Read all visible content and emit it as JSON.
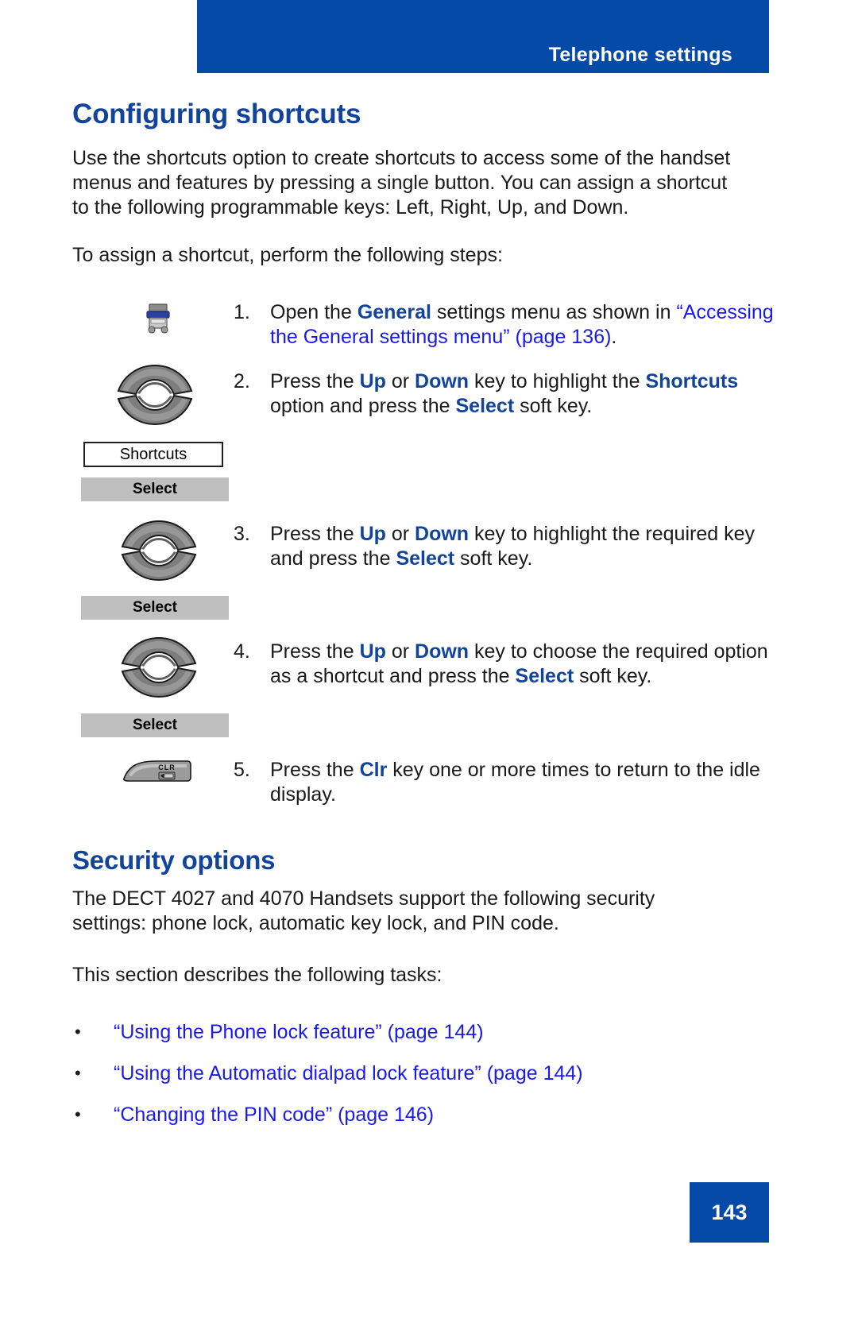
{
  "header": {
    "title": "Telephone settings",
    "bar_color": "#054aa6"
  },
  "sections": {
    "shortcuts": {
      "heading": "Configuring shortcuts",
      "intro": "Use the shortcuts option to create shortcuts to access some of the handset menus and features by pressing a single button. You can assign a shortcut to the following programmable keys: Left, Right, Up, and Down.",
      "lead_in": "To assign a shortcut, perform the following steps:"
    },
    "security": {
      "heading": "Security options",
      "para1": "The DECT 4027 and 4070 Handsets support the following security settings: phone lock, automatic key lock, and PIN code.",
      "para2": "This section describes the following tasks:"
    }
  },
  "steps": [
    {
      "number": "1.",
      "line1_pre": "Open the ",
      "line1_bold": "General",
      "line1_post": " settings menu as shown in",
      "link_text": "“Accessing the General settings menu” (page 136)",
      "link_tail": "."
    },
    {
      "number": "2.",
      "t1": "Press the ",
      "b1": "Up",
      "t2": " or ",
      "b2": "Down",
      "t3": " key to highlight the ",
      "b3": "Shortcuts",
      "t4": " option and press the ",
      "b4": "Select",
      "t5": " soft key."
    },
    {
      "number": "3.",
      "t1": "Press the ",
      "b1": "Up",
      "t2": " or ",
      "b2": "Down",
      "t3": " key to highlight the required key and press the ",
      "b3": "Select",
      "t4": " soft key."
    },
    {
      "number": "4.",
      "t1": "Press the ",
      "b1": "Up",
      "t2": " or ",
      "b2": "Down",
      "t3": " key to choose the required option as a shortcut and press the ",
      "b3": "Select",
      "t4": " soft key."
    },
    {
      "number": "5.",
      "t1": "Press the ",
      "b1": "Clr",
      "t2": " key one or more times to return to the idle display."
    }
  ],
  "key_graphics": {
    "menu_box_label": "Shortcuts",
    "softkey_label_1": "Select",
    "softkey_label_2": "Select",
    "softkey_label_3": "Select",
    "clr_label": "CLR"
  },
  "bullets": [
    {
      "text": "“Using the Phone lock feature” (page 144)"
    },
    {
      "text": "“Using the Automatic dialpad lock feature” (page 144)"
    },
    {
      "text": "“Changing the PIN code” (page 146)"
    }
  ],
  "footer": {
    "page_number": "143"
  },
  "colors": {
    "brand_blue": "#054aa6",
    "heading_blue": "#12449b",
    "link_blue": "#1a1aee",
    "softkey_grey": "#bfbfbf"
  }
}
